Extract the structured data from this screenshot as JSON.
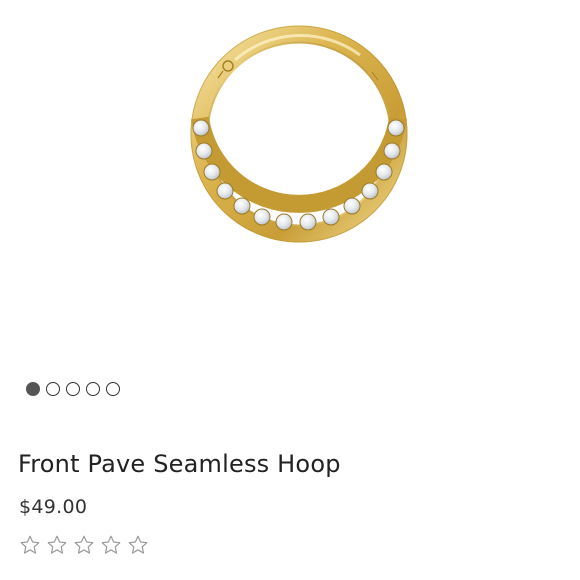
{
  "product": {
    "image_alt": "Gold front pave seamless hoop with clear crystals",
    "title": "Front Pave Seamless Hoop",
    "price": "$49.00"
  },
  "carousel": {
    "count": 5,
    "active_index": 0
  },
  "rating": {
    "max": 5,
    "value": 0
  },
  "colors": {
    "gold_light": "#f3dc92",
    "gold": "#d8b24a",
    "gold_dark": "#a47f22",
    "crystal": "#eef1f4",
    "star_outline": "#9a9a9a",
    "dot_active": "#555555"
  }
}
